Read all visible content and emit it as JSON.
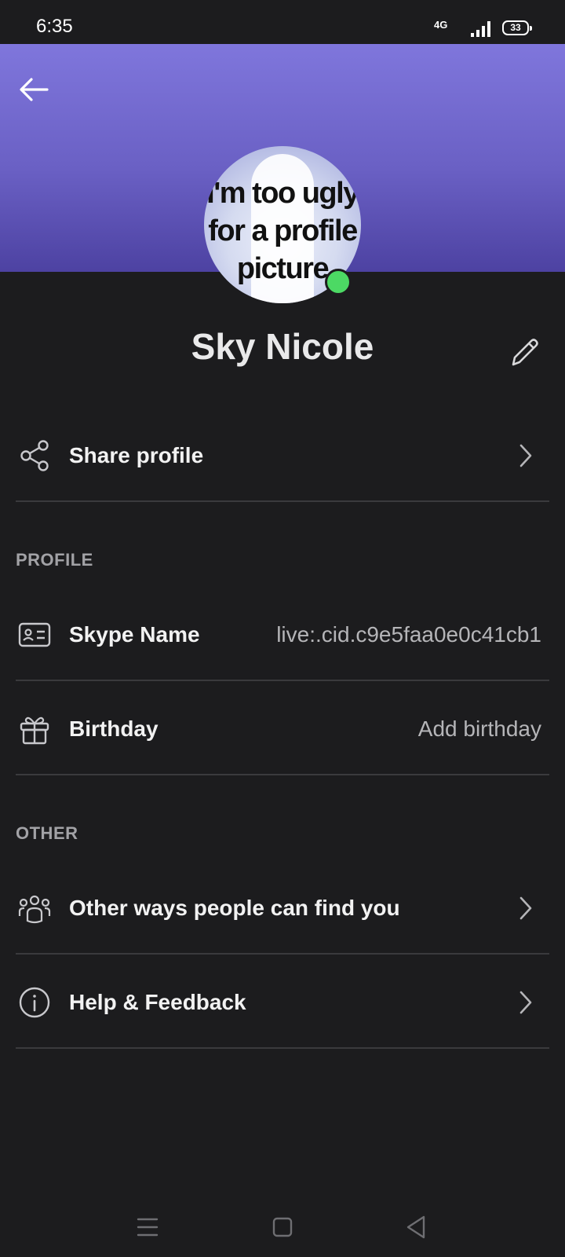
{
  "status_bar": {
    "time": "6:35",
    "network": "4G",
    "battery": "33"
  },
  "profile": {
    "avatar_text": "I'm too ugly\nfor a profile\npicture",
    "name": "Sky Nicole",
    "presence_color": "#4cd964"
  },
  "share": {
    "label": "Share profile"
  },
  "sections": {
    "profile": "PROFILE",
    "other": "OTHER"
  },
  "skype_name": {
    "label": "Skype Name",
    "value": "live:.cid.c9e5faa0e0c41cb1"
  },
  "birthday": {
    "label": "Birthday",
    "value": "Add birthday"
  },
  "find_you": {
    "label": "Other ways people can find you"
  },
  "help": {
    "label": "Help & Feedback"
  },
  "icons": {
    "back": "arrow-left-icon",
    "edit": "pencil-icon",
    "share": "share-icon",
    "skype_name": "id-card-icon",
    "birthday": "gift-icon",
    "find_you": "people-group-icon",
    "help": "info-icon",
    "nav_menu": "menu-icon",
    "nav_home": "square-icon",
    "nav_back": "triangle-back-icon"
  },
  "colors": {
    "background": "#1c1c1e",
    "header_top": "#7f76dc",
    "header_bottom": "#4d42a2",
    "secondary_text": "#b5b5b8"
  }
}
